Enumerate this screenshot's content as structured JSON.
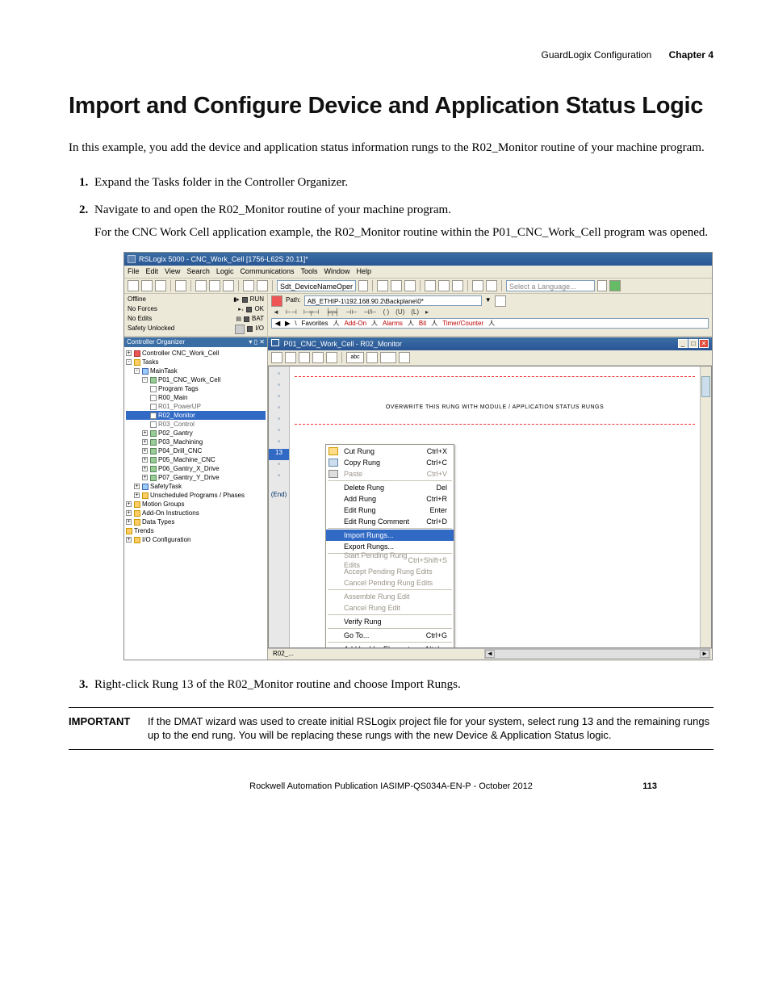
{
  "header": {
    "breadcrumb": "GuardLogix Configuration",
    "chapter": "Chapter 4"
  },
  "title": "Import and Configure Device and Application Status Logic",
  "intro": "In this example, you add the device and application status information rungs to the R02_Monitor routine of your machine program.",
  "steps": {
    "s1": "Expand the Tasks folder in the Controller Organizer.",
    "s2": "Navigate to and open the R02_Monitor routine of your machine program.",
    "s2_follow": "For the CNC Work Cell application example, the R02_Monitor routine within the P01_CNC_Work_Cell program was opened.",
    "s3": "Right-click Rung 13 of the R02_Monitor routine and choose Import Rungs."
  },
  "app": {
    "title": "RSLogix 5000 - CNC_Work_Cell [1756-L62S 20.11]*",
    "menu": [
      "File",
      "Edit",
      "View",
      "Search",
      "Logic",
      "Communications",
      "Tools",
      "Window",
      "Help"
    ],
    "combo": "Sdt_DeviceNameOper",
    "lang_placeholder": "Select a Language...",
    "status": {
      "r1l": "Offline",
      "r1r": "RUN",
      "r2l": "No Forces",
      "r2r": "OK",
      "r3l": "No Edits",
      "r3r": "BAT",
      "r4l": "Safety Unlocked",
      "r4r": "I/O"
    },
    "path_label": "Path:",
    "path": "AB_ETHIP-1\\192.168.90.2\\Backplane\\0*",
    "ladder_tabs": [
      "Favorites",
      "Add-On",
      "Alarms",
      "Bit",
      "Timer/Counter"
    ],
    "organizer_title": "Controller Organizer",
    "tree": {
      "controller": "Controller CNC_Work_Cell",
      "tasks": "Tasks",
      "mainTask": "MainTask",
      "p01": "P01_CNC_Work_Cell",
      "progTags": "Program Tags",
      "r00": "R00_Main",
      "r01g": "R01_PowerUP",
      "r02": "R02_Monitor",
      "r03g": "R03_Control",
      "p02": "P02_Gantry",
      "p03": "P03_Machining",
      "p04": "P04_Drill_CNC",
      "p05": "P05_Machine_CNC",
      "p06": "P06_Gantry_X_Drive",
      "p07": "P07_Gantry_Y_Drive",
      "safetyTask": "SafetyTask",
      "unsched": "Unscheduled Programs / Phases",
      "motion": "Motion Groups",
      "addon": "Add-On Instructions",
      "dtypes": "Data Types",
      "trends": "Trends",
      "iocfg": "I/O Configuration"
    },
    "editor_title": "P01_CNC_Work_Cell - R02_Monitor",
    "rung_note": "OVERWRITE THIS RUNG WITH MODULE / APPLICATION STATUS RUNGS",
    "rung13": "13",
    "rung_end": "(End)",
    "bottom_tab": "R02_...",
    "ctx": {
      "cut": "Cut Rung",
      "cut_k": "Ctrl+X",
      "copy": "Copy Rung",
      "copy_k": "Ctrl+C",
      "paste": "Paste",
      "paste_k": "Ctrl+V",
      "del": "Delete Rung",
      "del_k": "Del",
      "add": "Add Rung",
      "add_k": "Ctrl+R",
      "edit": "Edit Rung",
      "edit_k": "Enter",
      "editc": "Edit Rung Comment",
      "editc_k": "Ctrl+D",
      "import": "Import Rungs...",
      "export": "Export Rungs...",
      "start": "Start Pending Rung Edits",
      "start_k": "Ctrl+Shift+S",
      "accept": "Accept Pending Rung Edits",
      "cancel": "Cancel Pending Rung Edits",
      "assemble": "Assemble Rung Edit",
      "cancele": "Cancel Rung Edit",
      "verify": "Verify Rung",
      "goto": "Go To...",
      "goto_k": "Ctrl+G",
      "addle": "Add Ladder Element...",
      "addle_k": "Alt+Ins"
    }
  },
  "important": {
    "label": "IMPORTANT",
    "text": "If the DMAT wizard was used to create initial RSLogix project file for your system, select rung 13 and the remaining rungs up to the end rung. You will be replacing these rungs with the new Device & Application Status logic."
  },
  "footer": {
    "pub": "Rockwell Automation Publication IASIMP-QS034A-EN-P - ",
    "date": "October 2012",
    "page": "113"
  }
}
